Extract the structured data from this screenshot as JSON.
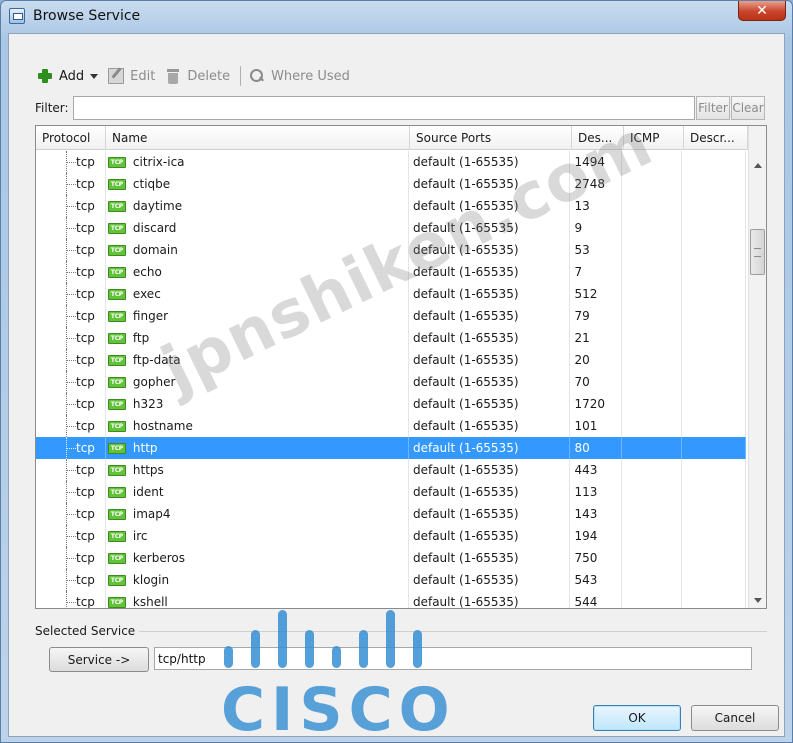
{
  "window": {
    "title": "Browse Service",
    "close_glyph": "✕"
  },
  "toolbar": {
    "add_label": "Add",
    "edit_label": "Edit",
    "delete_label": "Delete",
    "where_used_label": "Where Used"
  },
  "filter": {
    "label": "Filter:",
    "value": "",
    "filter_label": "Filter",
    "clear_label": "Clear"
  },
  "table": {
    "columns": [
      "Protocol",
      "Name",
      "Source Ports",
      "Des...",
      "ICMP",
      "Descr..."
    ],
    "badge": "TCP",
    "rows": [
      {
        "protocol": "tcp",
        "name": "citrix-ica",
        "source": "default (1-65535)",
        "dest": "1494"
      },
      {
        "protocol": "tcp",
        "name": "ctiqbe",
        "source": "default (1-65535)",
        "dest": "2748"
      },
      {
        "protocol": "tcp",
        "name": "daytime",
        "source": "default (1-65535)",
        "dest": "13"
      },
      {
        "protocol": "tcp",
        "name": "discard",
        "source": "default (1-65535)",
        "dest": "9"
      },
      {
        "protocol": "tcp",
        "name": "domain",
        "source": "default (1-65535)",
        "dest": "53"
      },
      {
        "protocol": "tcp",
        "name": "echo",
        "source": "default (1-65535)",
        "dest": "7"
      },
      {
        "protocol": "tcp",
        "name": "exec",
        "source": "default (1-65535)",
        "dest": "512"
      },
      {
        "protocol": "tcp",
        "name": "finger",
        "source": "default (1-65535)",
        "dest": "79"
      },
      {
        "protocol": "tcp",
        "name": "ftp",
        "source": "default (1-65535)",
        "dest": "21"
      },
      {
        "protocol": "tcp",
        "name": "ftp-data",
        "source": "default (1-65535)",
        "dest": "20"
      },
      {
        "protocol": "tcp",
        "name": "gopher",
        "source": "default (1-65535)",
        "dest": "70"
      },
      {
        "protocol": "tcp",
        "name": "h323",
        "source": "default (1-65535)",
        "dest": "1720"
      },
      {
        "protocol": "tcp",
        "name": "hostname",
        "source": "default (1-65535)",
        "dest": "101"
      },
      {
        "protocol": "tcp",
        "name": "http",
        "source": "default (1-65535)",
        "dest": "80",
        "selected": true
      },
      {
        "protocol": "tcp",
        "name": "https",
        "source": "default (1-65535)",
        "dest": "443"
      },
      {
        "protocol": "tcp",
        "name": "ident",
        "source": "default (1-65535)",
        "dest": "113"
      },
      {
        "protocol": "tcp",
        "name": "imap4",
        "source": "default (1-65535)",
        "dest": "143"
      },
      {
        "protocol": "tcp",
        "name": "irc",
        "source": "default (1-65535)",
        "dest": "194"
      },
      {
        "protocol": "tcp",
        "name": "kerberos",
        "source": "default (1-65535)",
        "dest": "750"
      },
      {
        "protocol": "tcp",
        "name": "klogin",
        "source": "default (1-65535)",
        "dest": "543"
      },
      {
        "protocol": "tcp",
        "name": "kshell",
        "source": "default (1-65535)",
        "dest": "544"
      }
    ]
  },
  "selected_service": {
    "label": "Selected Service",
    "service_button_label": "Service ->",
    "value": "tcp/http"
  },
  "dialog": {
    "ok_label": "OK",
    "cancel_label": "Cancel"
  },
  "overlay": {
    "watermark": "jpnshiken.com",
    "logo_text": "CISCO"
  },
  "colors": {
    "selection": "#3399ff",
    "tcp_badge": "#62c23a",
    "logo": "#348ed2"
  }
}
